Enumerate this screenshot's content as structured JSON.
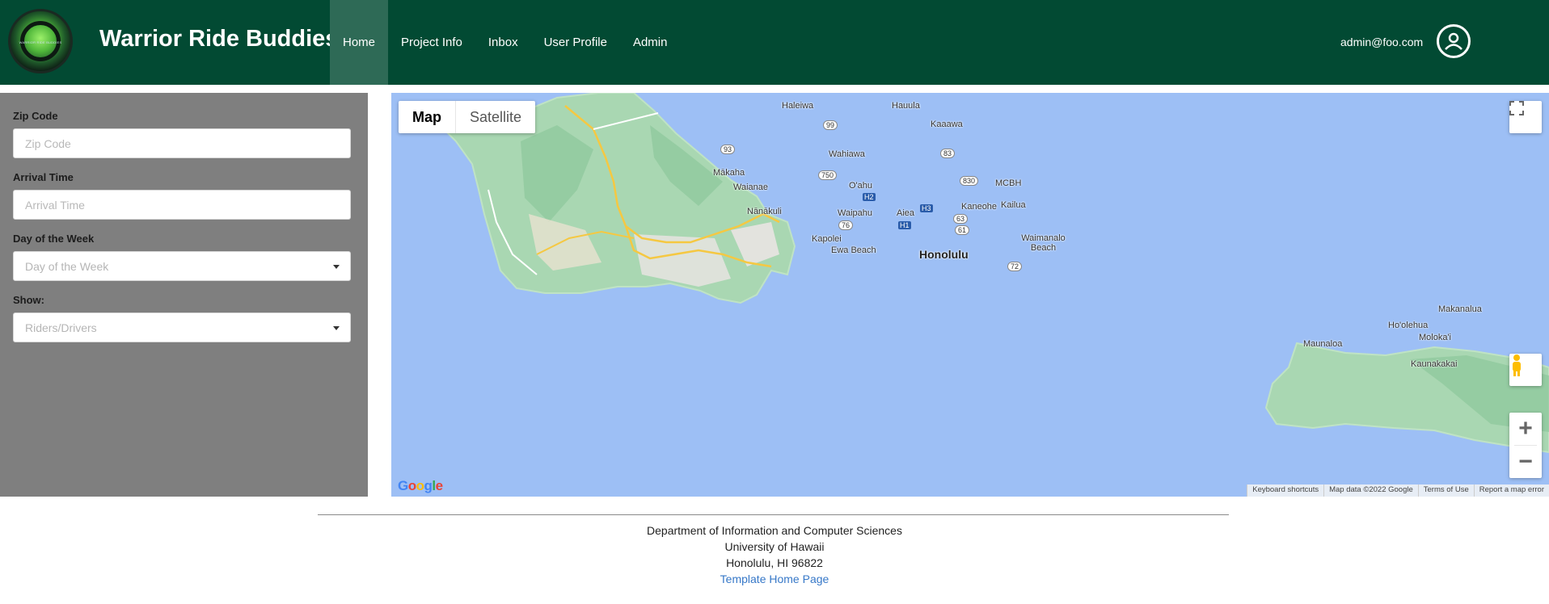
{
  "navbar": {
    "logo_text": "WARRIOR RIDE BUDDIES",
    "brand": "Warrior Ride Buddies",
    "items": [
      {
        "label": "Home",
        "active": true
      },
      {
        "label": "Project Info",
        "active": false
      },
      {
        "label": "Inbox",
        "active": false
      },
      {
        "label": "User Profile",
        "active": false
      },
      {
        "label": "Admin",
        "active": false
      }
    ],
    "user_email": "admin@foo.com",
    "colors": {
      "background": "#024a33",
      "active": "#2e6a56"
    }
  },
  "sidebar": {
    "zip": {
      "label": "Zip Code",
      "placeholder": "Zip Code"
    },
    "arrival": {
      "label": "Arrival Time",
      "placeholder": "Arrival Time"
    },
    "day": {
      "label": "Day of the Week",
      "placeholder": "Day of the Week"
    },
    "show": {
      "label": "Show:",
      "placeholder": "Riders/Drivers"
    }
  },
  "map": {
    "type_buttons": [
      "Map",
      "Satellite"
    ],
    "places": {
      "haleiwa": "Haleiwa",
      "hauula": "Hauula",
      "kaaawa": "Kaaawa",
      "wahiawa": "Wahiawa",
      "makaha": "Mākaha",
      "waianae": "Waianae",
      "oahu": "O'ahu",
      "mcbh": "MCBH",
      "kaneohe": "Kaneohe",
      "kailua": "Kailua",
      "nanakuli": "Nānākuli",
      "waipahu": "Waipahu",
      "aiea": "Aiea",
      "waimanalo": "Waimanalo Beach",
      "kapolei": "Kapolei",
      "ewa": "Ewa Beach",
      "honolulu": "Honolulu",
      "makanalua": "Makanalua",
      "hoolehua": "Ho'olehua",
      "maunaloa": "Maunaloa",
      "molokai": "Moloka'i",
      "kaunakakai": "Kaunakakai"
    },
    "shields": [
      "99",
      "93",
      "83",
      "750",
      "830",
      "H2",
      "H3",
      "H1",
      "63",
      "76",
      "61",
      "72"
    ],
    "google_logo": "Google",
    "attribution": [
      "Keyboard shortcuts",
      "Map data ©2022 Google",
      "Terms of Use",
      "Report a map error"
    ]
  },
  "footer": {
    "line1": "Department of Information and Computer Sciences",
    "line2": "University of Hawaii",
    "line3": "Honolulu, HI 96822",
    "link": "Template Home Page"
  }
}
